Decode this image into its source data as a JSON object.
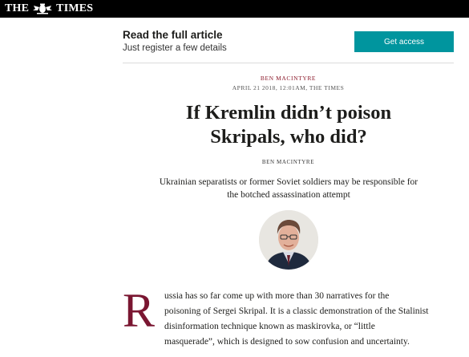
{
  "masthead": {
    "left": "THE",
    "right": "TIMES",
    "crest_icon": "royal-crest-icon"
  },
  "register": {
    "title": "Read the full article",
    "subtitle": "Just register a few details",
    "cta_label": "Get access",
    "cta_color": "#00959e"
  },
  "article": {
    "byline_top": "BEN MACINTYRE",
    "dateline": "APRIL 21 2018, 12:01AM, THE TIMES",
    "headline_line1": "If Kremlin didn’t poison",
    "headline_line2": "Skripals, who did?",
    "byline": "BEN MACINTYRE",
    "standfirst_line1": "Ukrainian separatists or former Soviet soldiers may be responsible for",
    "standfirst_line2": "the botched assassination attempt",
    "author_photo": "author-headshot",
    "drop_cap": "R",
    "body_line1": "ussia has so far come up with more than 30 narratives for the",
    "body_line2": "poisoning of Sergei Skripal. It is a classic demonstration of the Stalinist",
    "body_line3": "disinformation technique known as maskirovka, or “little",
    "body_line4": "masquerade”, which is designed to sow confusion and uncertainty.",
    "accent_color": "#7a1631"
  }
}
